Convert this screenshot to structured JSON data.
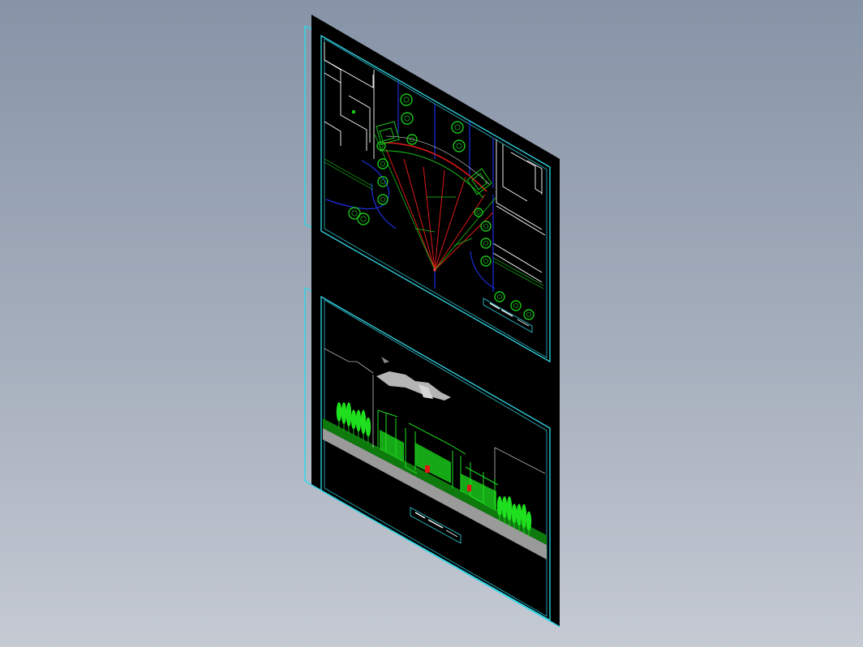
{
  "viewport": {
    "background_top": "#8794a7",
    "background_bottom": "#c5cad3"
  },
  "sheet": {
    "paper_color": "#000000",
    "frame_color": "#31d7e6"
  },
  "plan_drawing": {
    "title_block_text": "",
    "tree_color": "#18c418",
    "road_color": "#1c2fe0",
    "radial_color": "#e01818",
    "building_color": "#ffffff"
  },
  "elevation_drawing": {
    "title_block_text": "",
    "vegetation_color": "#1fe01f",
    "ground_color": "#9a9a9a",
    "accent_color": "#e01818"
  }
}
